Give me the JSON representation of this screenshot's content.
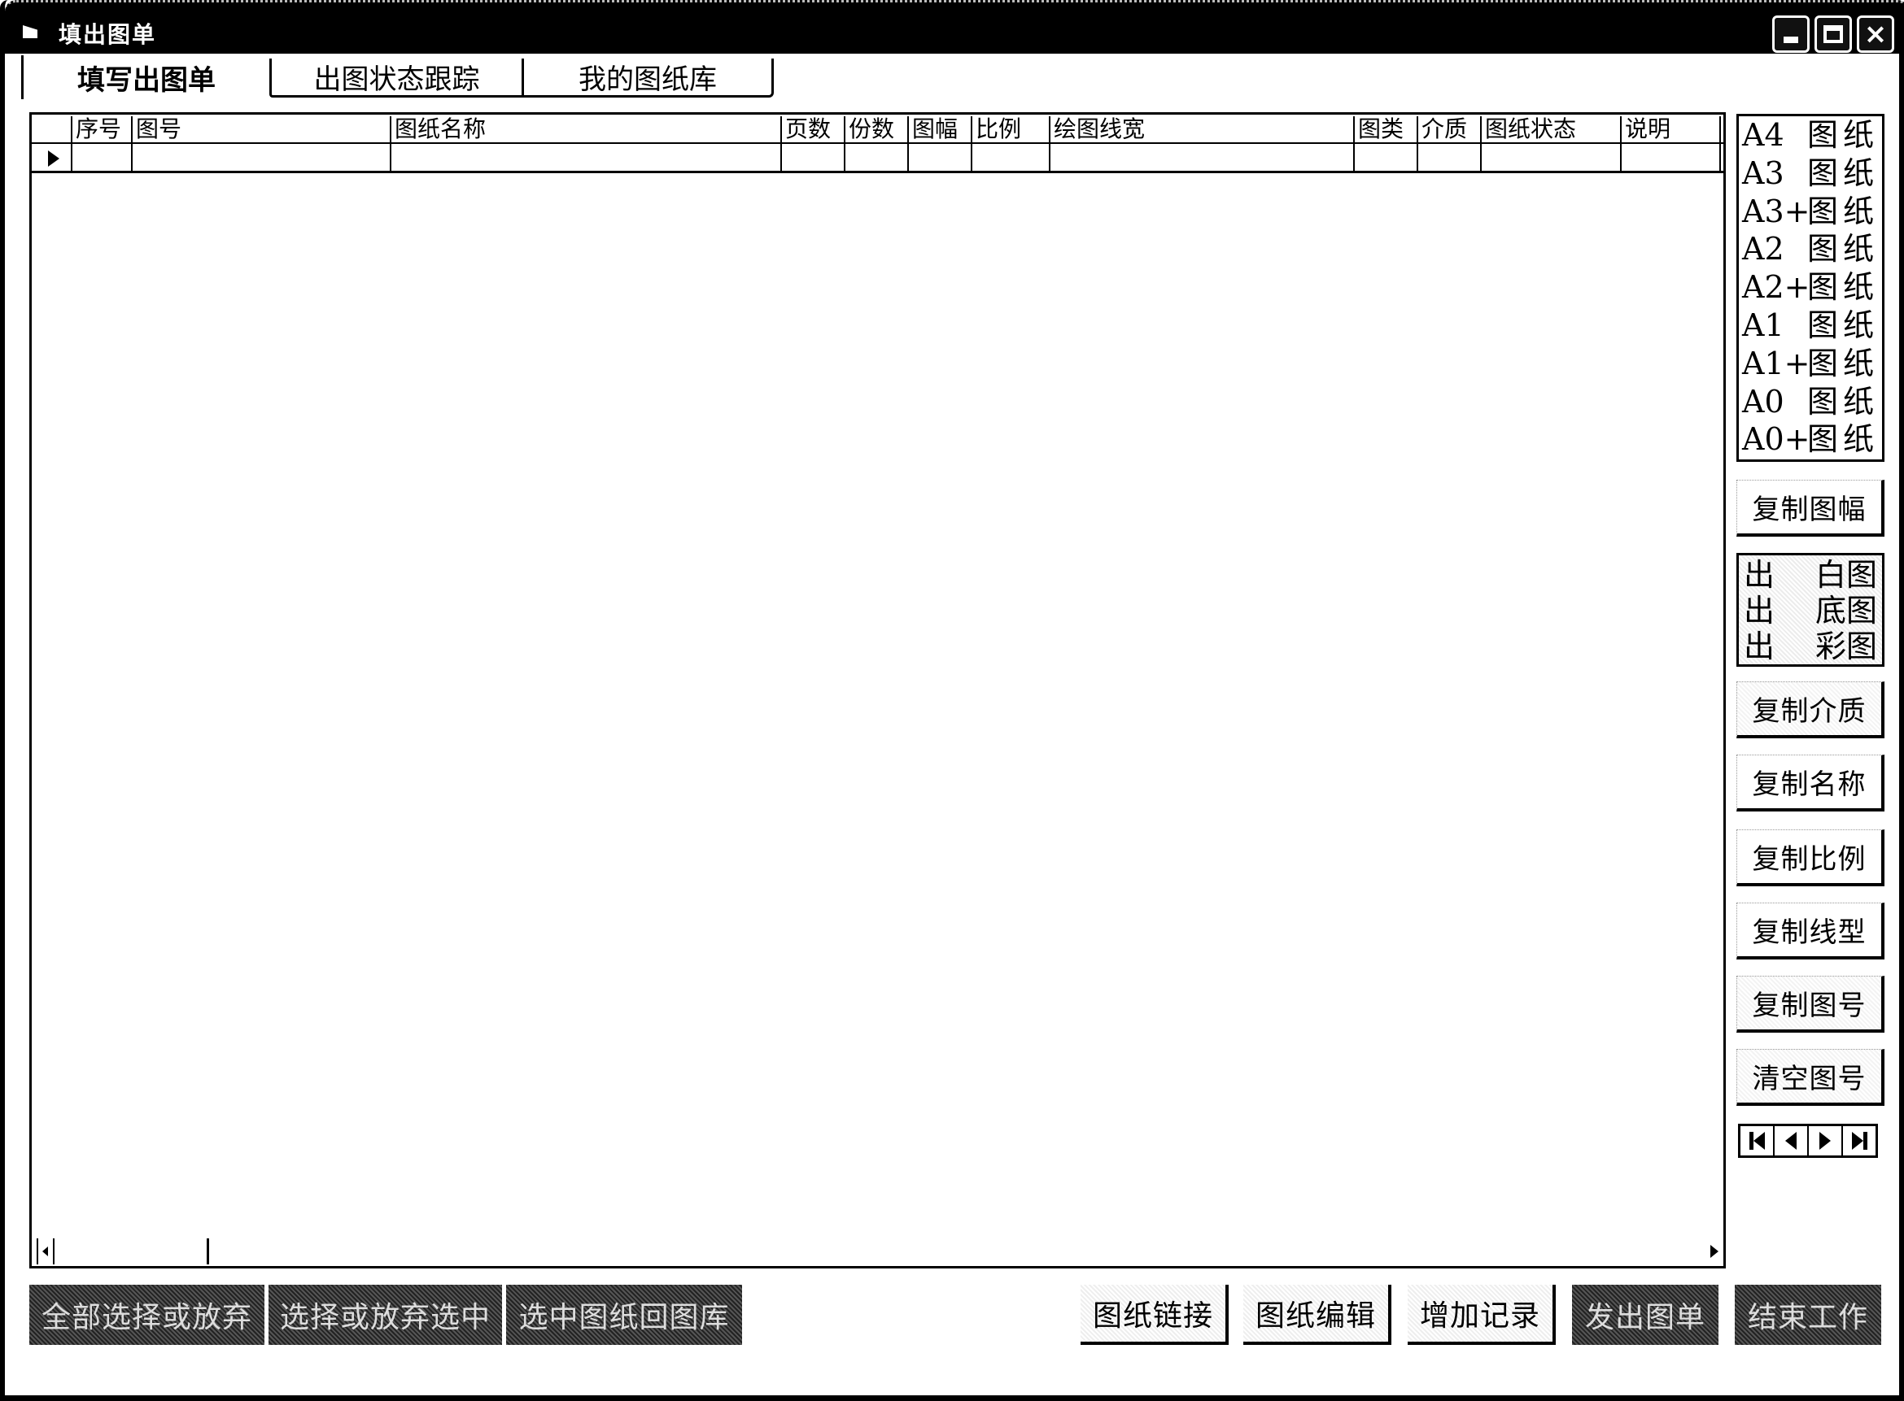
{
  "window": {
    "title": "填出图单",
    "controls": {
      "minimize": "minimize",
      "maximize": "maximize",
      "close": "×"
    }
  },
  "tabs": [
    {
      "label": "填写出图单",
      "active": true
    },
    {
      "label": "出图状态跟踪",
      "active": false
    },
    {
      "label": "我的图纸库",
      "active": false
    }
  ],
  "grid": {
    "columns": [
      "序号",
      "图号",
      "图纸名称",
      "页数",
      "份数",
      "图幅",
      "比例",
      "绘图线宽",
      "图类",
      "介质",
      "图纸状态",
      "说明"
    ],
    "rows": [
      [
        "",
        "",
        "",
        "",
        "",
        "",
        "",
        "",
        "",
        "",
        "",
        ""
      ]
    ],
    "current_row_indicator": "▶"
  },
  "paper_sizes": [
    {
      "size": "A4",
      "label": "图纸"
    },
    {
      "size": "A3",
      "label": "图纸"
    },
    {
      "size": "A3+",
      "label": "图纸"
    },
    {
      "size": "A2",
      "label": "图纸"
    },
    {
      "size": "A2+",
      "label": "图纸"
    },
    {
      "size": "A1",
      "label": "图纸"
    },
    {
      "size": "A1+",
      "label": "图纸"
    },
    {
      "size": "A0",
      "label": "图纸"
    },
    {
      "size": "A0+",
      "label": "图纸"
    }
  ],
  "output_types": [
    {
      "prefix": "出",
      "type": "白图"
    },
    {
      "prefix": "出",
      "type": "底图"
    },
    {
      "prefix": "出",
      "type": "彩图"
    }
  ],
  "side_buttons": {
    "copy_size": "复制图幅",
    "copy_medium": "复制介质",
    "copy_name": "复制名称",
    "copy_scale": "复制比例",
    "copy_linetype": "复制线型",
    "copy_number": "复制图号",
    "clear_number": "清空图号"
  },
  "bottom_buttons": {
    "select_all": "全部选择或放弃",
    "select_toggle": "选择或放弃选中",
    "return_to_library": "选中图纸回图库",
    "drawing_link": "图纸链接",
    "drawing_edit": "图纸编辑",
    "add_record": "增加记录",
    "issue_form": "发出图单",
    "end_work": "结束工作"
  }
}
